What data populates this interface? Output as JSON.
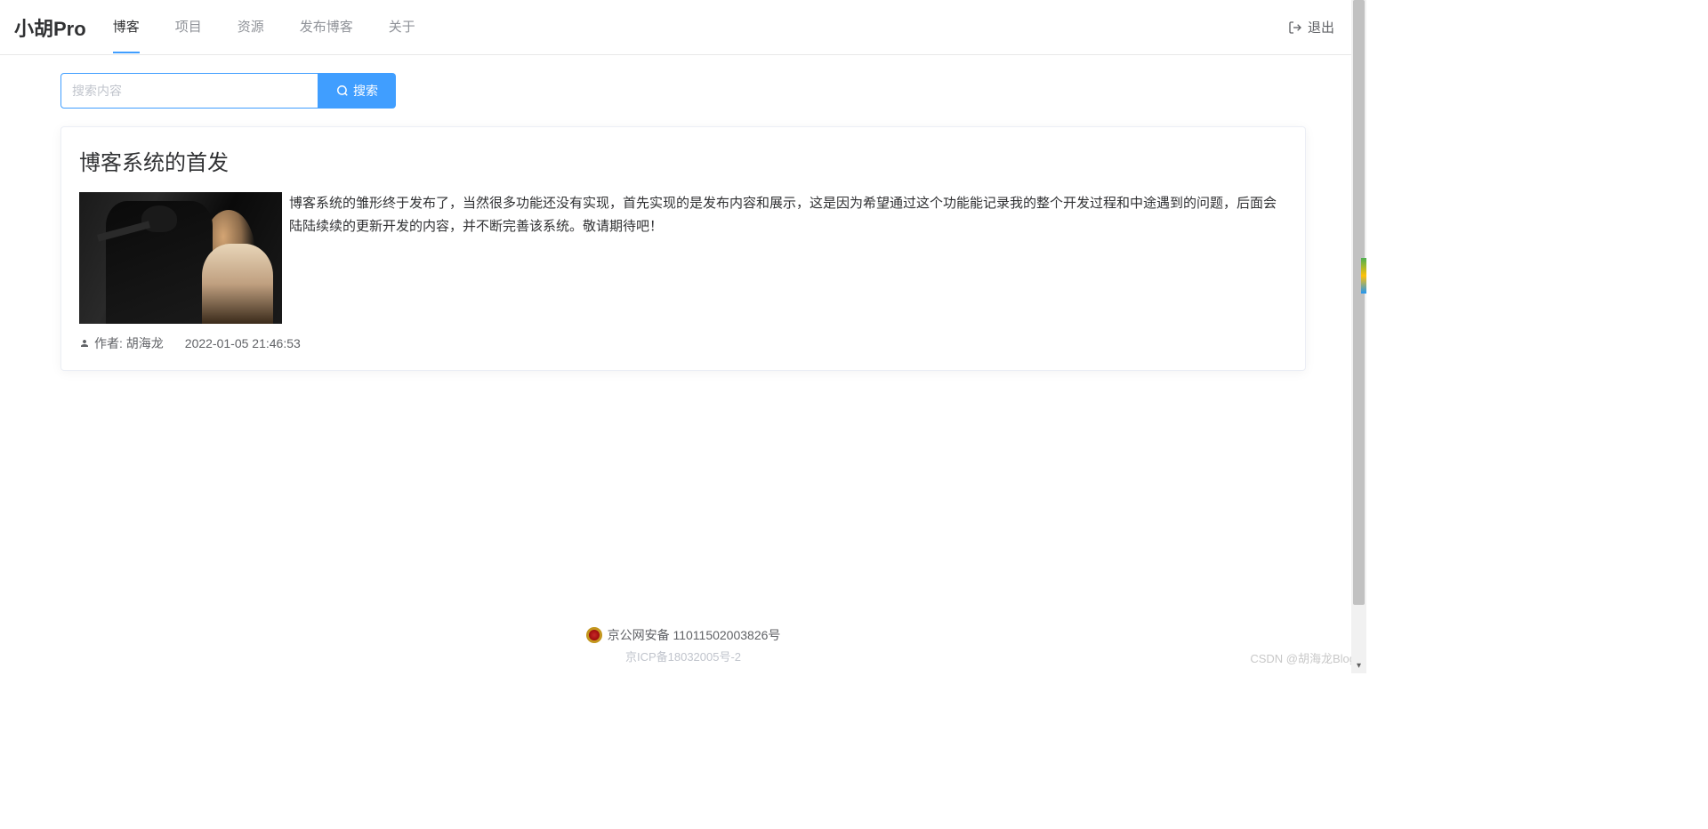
{
  "brand": "小胡Pro",
  "nav": {
    "items": [
      {
        "label": "博客",
        "active": true
      },
      {
        "label": "项目",
        "active": false
      },
      {
        "label": "资源",
        "active": false
      },
      {
        "label": "发布博客",
        "active": false
      },
      {
        "label": "关于",
        "active": false
      }
    ],
    "logout": "退出"
  },
  "search": {
    "placeholder": "搜索内容",
    "button": "搜索"
  },
  "post": {
    "title": "博客系统的首发",
    "summary": "博客系统的雏形终于发布了，当然很多功能还没有实现，首先实现的是发布内容和展示，这是因为希望通过这个功能能记录我的整个开发过程和中途遇到的问题，后面会陆陆续续的更新开发的内容，并不断完善该系统。敬请期待吧！",
    "author_label": "作者: 胡海龙",
    "timestamp": "2022-01-05 21:46:53"
  },
  "footer": {
    "beian": "京公网安备 11011502003826号",
    "icp_partial": "京ICP备18032005号-2"
  },
  "watermark": "CSDN @胡海龙Blog"
}
